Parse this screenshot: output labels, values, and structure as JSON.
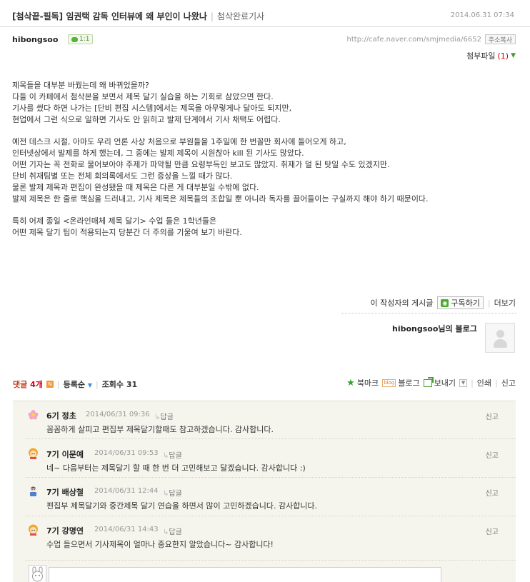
{
  "post": {
    "title": "[첨삭끝-필독] 임권택 감독 인터뷰에 왜 부인이 나왔나",
    "menu": "첨삭완료기사",
    "date": "2014.06.31 07:34",
    "author": "hibongsoo",
    "chat_label": "1:1",
    "url": "http://cafe.naver.com/smjmedia/6652",
    "copy_label": "주소복사",
    "attachment_label": "첨부파일",
    "attachment_count": "(1)",
    "body": [
      "제목들을 대부분 바꿨는데 왜 바뀌었을까?",
      "다들 이 카페에서 첨삭본을 보면서 제목 달기 실습을 하는 기회로 삼았으면 한다.",
      "기사를 썼다 하면 나가는 [단비 편집 시스템]에서는 제목을 아무렇게나 달아도 되지만,",
      "현업에서 그런 식으로 일하면 기사도 안 읽히고 발제 단계에서 기사 채택도 어렵다.",
      "",
      "예전 데스크 시절, 아마도 우리 언론 사상 처음으로 부원들을 1주일에 한 번꼴만 회사에 들어오게 하고,",
      "인터넷상에서 발제를 하게 했는데, 그 중에는 발제 제목이 시원찮아 kill 된 기사도 많았다.",
      "어떤 기자는 꼭 전화로 물어보아야 주제가 파악될 만큼 요령부득인 보고도 많았지. 취재가 덜 된 탓일 수도 있겠지만.",
      "단비 취재팀별 또는 전체 회의록에서도 그런 증상을 느낄 때가 많다.",
      "물론 발제 제목과 편집이 완성됐을 때 제목은 다른 게 대부분일 수밖에 없다.",
      "발제 제목은 한 줄로 핵심을 드러내고, 기사 제목은 제목들의 조합일 뿐 아니라 독자를 끌어들이는 구실까지 해야 하기 때문이다.",
      "",
      "특히 어제 종일 <온라인매체 제목 달기> 수업 들은 1학년들은",
      "어떤 제목 달기 팁이 적용되는지 당분간 더 주의를 기울여 보기 바란다."
    ]
  },
  "writer_links": {
    "posts_label": "이 작성자의 게시글",
    "subscribe_label": "구독하기",
    "more_label": "더보기"
  },
  "blog": {
    "name": "hibongsoo님의 블로그"
  },
  "comment_bar": {
    "label": "댓글",
    "count": "4개",
    "new_badge": "N",
    "sort_label": "등록순",
    "views_label": "조회수",
    "views_count": "31",
    "bookmark_label": "북마크",
    "blog_label": "블로그",
    "send_label": "보내기",
    "print_label": "인쇄",
    "report_label": "신고"
  },
  "comments": [
    {
      "name": "6기 정초",
      "date": "2014/06/31 09:36",
      "reply": "답글",
      "report": "신고",
      "text": "꼼꼼하게 살피고 편집부 제목달기할때도 참고하겠습니다. 감사합니다.",
      "avatar": "flower-icon"
    },
    {
      "name": "7기 이문예",
      "date": "2014/06/31 09:53",
      "reply": "답글",
      "report": "신고",
      "text": "네~ 다음부터는 제목달기 할 때 한 번 더 고민해보고 달겠습니다. 감사합니다 :)",
      "avatar": "girl-icon"
    },
    {
      "name": "7기 배상철",
      "date": "2014/06/31 12:44",
      "reply": "답글",
      "report": "신고",
      "text": "편집부 제목달기와 중간제목 달기 연습을 하면서 많이 고민하겠습니다. 감사합니다.",
      "avatar": "boy-icon"
    },
    {
      "name": "7기 강명연",
      "date": "2014/06/31 14:43",
      "reply": "답글",
      "report": "신고",
      "text": "수업 들으면서 기사제목이 얼마나 중요한지 알았습니다~ 감사합니다!",
      "avatar": "girl-icon"
    }
  ],
  "colors": {
    "comment_count": "#d0021b",
    "accent_green": "#4bab31",
    "comment_panel_bg": "#f5f5ee"
  }
}
